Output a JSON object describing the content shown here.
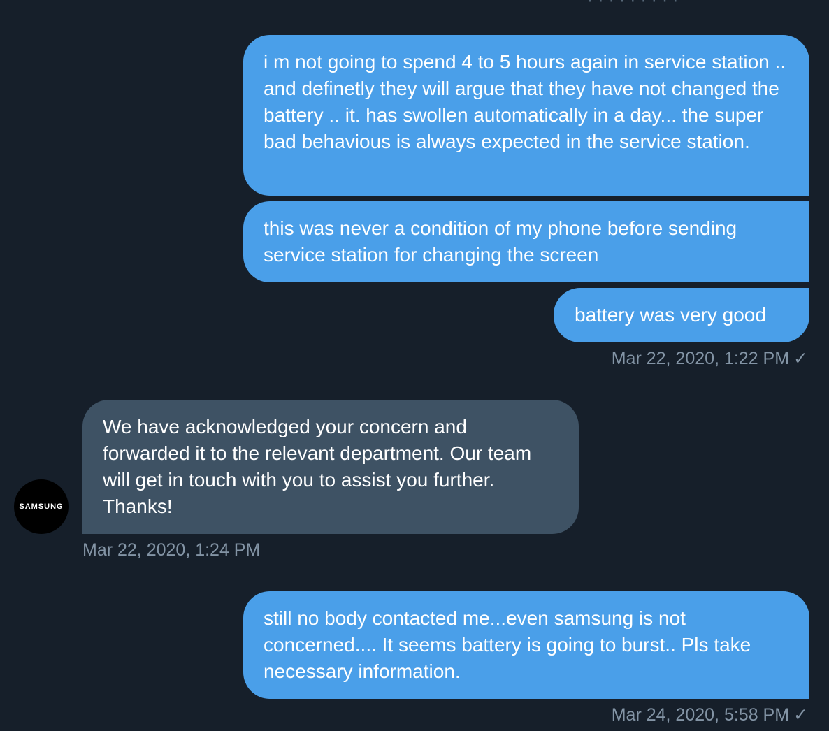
{
  "messages": [
    {
      "direction": "outgoing",
      "text": "i m not going to spend 4 to 5 hours again in service station .. and definetly they will argue that they have not changed the battery .. it. has swollen automatically in a day... the super bad behavious is always expected in the service station."
    },
    {
      "direction": "outgoing",
      "text": "this was never a condition of my phone before sending service station for changing the screen"
    },
    {
      "direction": "outgoing",
      "text": "battery was very good"
    },
    {
      "direction": "incoming",
      "text": "We have acknowledged your concern and forwarded it to the relevant department. Our team will get in touch with you to assist you further. Thanks!"
    },
    {
      "direction": "outgoing",
      "text": "still no body contacted me...even samsung is not concerned.... It seems battery is going to burst.. Pls take necessary information."
    }
  ],
  "timestamps": {
    "group1": "Mar 22, 2020, 1:22 PM",
    "group2": "Mar 22, 2020, 1:24 PM",
    "group3": "Mar 24, 2020, 5:58 PM"
  },
  "read_receipt": "✓",
  "sender": {
    "avatar_text": "SAMSUNG"
  },
  "colors": {
    "background": "#161f2a",
    "outgoing_bubble": "#4a9fe9",
    "incoming_bubble": "#3e5264",
    "timestamp": "#8394a5"
  }
}
